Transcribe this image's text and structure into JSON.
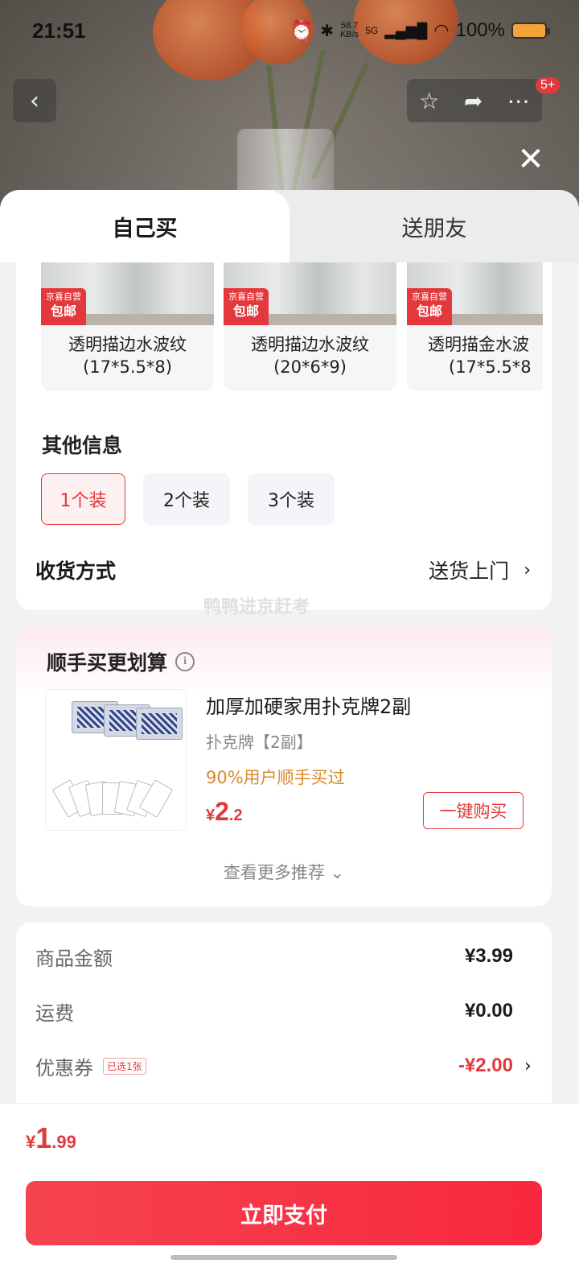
{
  "status_bar": {
    "time": "21:51",
    "net_speed": "58.7",
    "net_unit": "KB/s",
    "network": "5G",
    "battery": "100%"
  },
  "header": {
    "back_icon": "chevron-left-icon",
    "badge": "5+"
  },
  "tabs": [
    {
      "label": "自己买",
      "active": true
    },
    {
      "label": "送朋友",
      "active": false
    }
  ],
  "variants": [
    {
      "tag_top": "京喜自营",
      "tag_bottom": "包邮",
      "name_line1": "透明描边水波纹",
      "name_line2": "(17*5.5*8)"
    },
    {
      "tag_top": "京喜自营",
      "tag_bottom": "包邮",
      "name_line1": "透明描边水波纹",
      "name_line2": "(20*6*9)"
    },
    {
      "tag_top": "京喜自营",
      "tag_bottom": "包邮",
      "name_line1": "透明描金水波",
      "name_line2": "(17*5.5*8"
    }
  ],
  "other_info": {
    "title": "其他信息",
    "options": [
      "1个装",
      "2个装",
      "3个装"
    ],
    "selected": "1个装"
  },
  "shipping": {
    "label": "收货方式",
    "value": "送货上门"
  },
  "watermark": "鸭鸭进京赶考",
  "addon": {
    "title": "顺手买更划算",
    "product_name": "加厚加硬家用扑克牌2副",
    "spec": "扑克牌【2副】",
    "rate": "90%用户顺手买过",
    "price_symbol": "¥",
    "price_int": "2",
    "price_dec": ".2",
    "buy_label": "一键购买",
    "more_label": "查看更多推荐"
  },
  "summary": {
    "goods_label": "商品金额",
    "goods_value": "¥3.99",
    "freight_label": "运费",
    "freight_value": "¥0.00",
    "coupon_label": "优惠券",
    "coupon_tag": "已选1张",
    "coupon_value": "-¥2.00"
  },
  "footer": {
    "total_symbol": "¥",
    "total_int": "1",
    "total_dec": ".99",
    "pay_label": "立即支付"
  },
  "colors": {
    "accent": "#e4393c",
    "orange_text": "#d88a2a"
  }
}
